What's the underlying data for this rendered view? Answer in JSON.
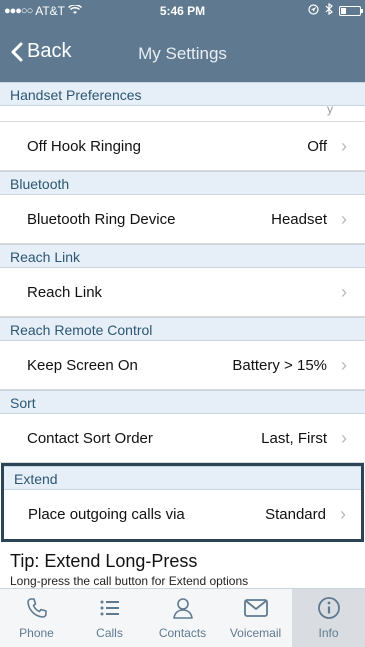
{
  "status_bar": {
    "carrier": "AT&T",
    "time": "5:46 PM",
    "battery_level": 0.3
  },
  "nav": {
    "back_label": "Back",
    "title": "My Settings"
  },
  "sections": [
    {
      "header": "Handset Preferences",
      "rows": [
        {
          "label": "Off Hook Ringing",
          "value": "Off"
        }
      ]
    },
    {
      "header": "Bluetooth",
      "rows": [
        {
          "label": "Bluetooth Ring Device",
          "value": "Headset"
        }
      ]
    },
    {
      "header": "Reach Link",
      "rows": [
        {
          "label": "Reach Link",
          "value": ""
        }
      ]
    },
    {
      "header": "Reach Remote Control",
      "rows": [
        {
          "label": "Keep Screen On",
          "value": "Battery > 15%"
        }
      ]
    },
    {
      "header": "Sort",
      "rows": [
        {
          "label": "Contact Sort Order",
          "value": "Last, First"
        }
      ]
    },
    {
      "header": "Extend",
      "rows": [
        {
          "label": "Place outgoing calls via",
          "value": "Standard"
        }
      ]
    }
  ],
  "tip": {
    "title": "Tip: Extend Long-Press",
    "text": "Long-press the call button for Extend options"
  },
  "tabs": [
    {
      "label": "Phone",
      "icon": "phone-icon"
    },
    {
      "label": "Calls",
      "icon": "list-icon"
    },
    {
      "label": "Contacts",
      "icon": "person-icon"
    },
    {
      "label": "Voicemail",
      "icon": "envelope-icon"
    },
    {
      "label": "Info",
      "icon": "info-icon",
      "active": true
    }
  ],
  "colors": {
    "bar": "#5f7a90",
    "section_bg": "#e6eff7",
    "section_text": "#2c5673",
    "highlight_border": "#2c4556"
  }
}
